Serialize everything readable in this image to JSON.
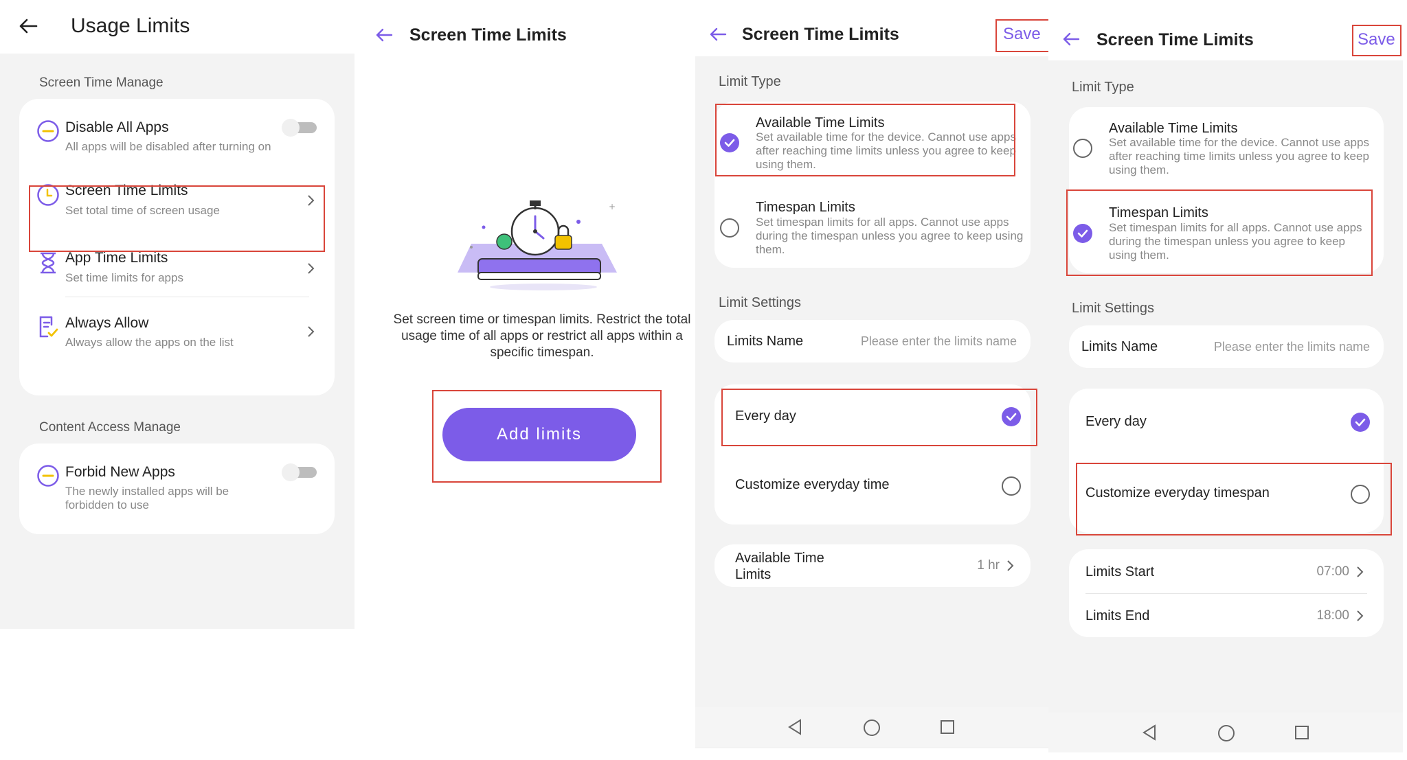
{
  "panel1": {
    "title": "Usage Limits",
    "screen_time_manage_label": "Screen Time Manage",
    "items": [
      {
        "title": "Disable All Apps",
        "desc": "All apps will be disabled after turning on"
      },
      {
        "title": "Screen Time Limits",
        "desc": "Set total time of screen usage"
      },
      {
        "title": "App Time Limits",
        "desc": "Set time limits for apps"
      },
      {
        "title": "Always Allow",
        "desc": "Always allow the apps on the list"
      }
    ],
    "content_access_label": "Content Access Manage",
    "forbid": {
      "title": "Forbid New Apps",
      "desc": "The newly installed apps will be forbidden to use"
    }
  },
  "panel2": {
    "title": "Screen Time Limits",
    "description": "Set screen time or timespan limits. Restrict the total usage time of all apps or restrict all apps within a specific timespan.",
    "add_button": "Add limits"
  },
  "panel3": {
    "title": "Screen Time Limits",
    "save": "Save",
    "limit_type_label": "Limit Type",
    "available": {
      "title": "Available Time Limits",
      "desc": "Set available time for the device. Cannot use apps after reaching time limits unless you agree to keep using them."
    },
    "timespan": {
      "title": "Timespan Limits",
      "desc": "Set timespan limits for all apps. Cannot use apps during the timespan unless you agree to keep using them."
    },
    "limit_settings_label": "Limit Settings",
    "limits_name_label": "Limits Name",
    "limits_name_placeholder": "Please enter the limits name",
    "every_day": "Every day",
    "customize": "Customize everyday time",
    "available_time_label": "Available Time Limits",
    "available_time_value": "1 hr"
  },
  "panel4": {
    "title": "Screen Time Limits",
    "save": "Save",
    "limit_type_label": "Limit Type",
    "available": {
      "title": "Available Time Limits",
      "desc": "Set available time for the device. Cannot use apps after reaching time limits unless you agree to keep using them."
    },
    "timespan": {
      "title": "Timespan Limits",
      "desc": "Set timespan limits for all apps. Cannot use apps during the timespan unless you agree to keep using them."
    },
    "limit_settings_label": "Limit Settings",
    "limits_name_label": "Limits Name",
    "limits_name_placeholder": "Please enter the limits name",
    "every_day": "Every day",
    "customize": "Customize everyday timespan",
    "limits_start_label": "Limits Start",
    "limits_start_value": "07:00",
    "limits_end_label": "Limits End",
    "limits_end_value": "18:00"
  },
  "colors": {
    "accent": "#7C5CE8",
    "highlight_box": "#D9453A",
    "panel_bg": "#F3F3F3",
    "icon_yellow": "#F2C200"
  },
  "icons": [
    "back-arrow-icon",
    "disable-icon",
    "clock-icon",
    "hourglass-icon",
    "allow-list-icon",
    "chevron-right-icon",
    "toggle-off-icon",
    "stopwatch-illustration",
    "nav-back-icon",
    "nav-home-icon",
    "nav-recent-icon"
  ]
}
